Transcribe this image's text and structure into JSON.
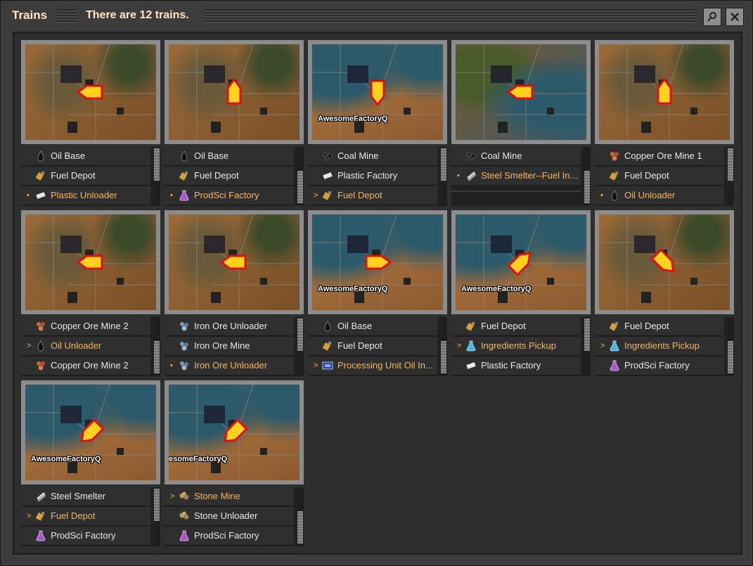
{
  "window": {
    "title": "Trains",
    "subtitle": "There are 12 trains.",
    "search_icon": "magnifier",
    "close_icon": "x"
  },
  "trains": [
    {
      "map": "dark-orange",
      "arrow": "left",
      "station_label": "",
      "stops": [
        {
          "label": "Oil Base",
          "icon": "oil-drop",
          "marker": "",
          "active": false
        },
        {
          "label": "Fuel Depot",
          "icon": "fuel",
          "marker": "",
          "active": false
        },
        {
          "label": "Plastic Unloader",
          "icon": "plastic",
          "marker": "•",
          "active": true
        }
      ]
    },
    {
      "map": "dark-orange",
      "arrow": "up",
      "station_label": "",
      "stops": [
        {
          "label": "Oil Base",
          "icon": "oil-drop",
          "marker": "",
          "active": false
        },
        {
          "label": "Fuel Depot",
          "icon": "fuel",
          "marker": "",
          "active": false
        },
        {
          "label": "ProdSci Factory",
          "icon": "purple-flask",
          "marker": "•",
          "active": true
        }
      ]
    },
    {
      "map": "blue-orange",
      "arrow": "down",
      "station_label": "AwesomeFactoryQ",
      "stops": [
        {
          "label": "Coal Mine",
          "icon": "coal",
          "marker": "",
          "active": false
        },
        {
          "label": "Plastic Factory",
          "icon": "plastic",
          "marker": "",
          "active": false
        },
        {
          "label": "Fuel Depot",
          "icon": "fuel",
          "marker": ">",
          "active": true
        }
      ]
    },
    {
      "map": "blue-green",
      "arrow": "left",
      "station_label": "",
      "stops": [
        {
          "label": "Coal Mine",
          "icon": "coal",
          "marker": "",
          "active": false
        },
        {
          "label": "Steel Smelter--Fuel In...",
          "icon": "steel",
          "marker": "•",
          "active": true
        }
      ]
    },
    {
      "map": "dark-orange",
      "arrow": "up",
      "station_label": "",
      "stops": [
        {
          "label": "Copper Ore Mine 1",
          "icon": "copper-ore",
          "marker": "",
          "active": false
        },
        {
          "label": "Fuel Depot",
          "icon": "fuel",
          "marker": "",
          "active": false
        },
        {
          "label": "Oil Unloader",
          "icon": "oil-drop",
          "marker": "•",
          "active": true
        }
      ]
    },
    {
      "map": "dark-orange",
      "arrow": "left",
      "station_label": "",
      "stops": [
        {
          "label": "Copper Ore Mine 2",
          "icon": "copper-ore",
          "marker": "",
          "active": false
        },
        {
          "label": "Oil Unloader",
          "icon": "oil-drop",
          "marker": ">",
          "active": true
        },
        {
          "label": "Copper Ore Mine 2",
          "icon": "copper-ore",
          "marker": "",
          "active": false
        }
      ]
    },
    {
      "map": "dark-orange",
      "arrow": "left",
      "station_label": "",
      "stops": [
        {
          "label": "Iron Ore Unloader",
          "icon": "iron-ore",
          "marker": "",
          "active": false
        },
        {
          "label": "Iron Ore Mine",
          "icon": "iron-ore",
          "marker": "",
          "active": false
        },
        {
          "label": "Iron Ore Unloader",
          "icon": "iron-ore",
          "marker": "•",
          "active": true
        }
      ]
    },
    {
      "map": "blue-orange",
      "arrow": "right",
      "station_label": "AwesomeFactoryQ",
      "stops": [
        {
          "label": "Oil Base",
          "icon": "oil-drop",
          "marker": "",
          "active": false
        },
        {
          "label": "Fuel Depot",
          "icon": "fuel",
          "marker": "",
          "active": false
        },
        {
          "label": "Processing Unit Oil In...",
          "icon": "processing-unit",
          "marker": ">",
          "active": true
        }
      ]
    },
    {
      "map": "blue-orange",
      "arrow": "up-right",
      "station_label": "AwesomeFactoryQ",
      "stops": [
        {
          "label": "Fuel Depot",
          "icon": "fuel",
          "marker": "",
          "active": false
        },
        {
          "label": "Ingredients Pickup",
          "icon": "blue-flask",
          "marker": ">",
          "active": true
        },
        {
          "label": "Plastic Factory",
          "icon": "plastic",
          "marker": "",
          "active": false
        }
      ]
    },
    {
      "map": "dark-orange",
      "arrow": "down-right",
      "station_label": "",
      "stops": [
        {
          "label": "Fuel Depot",
          "icon": "fuel",
          "marker": "",
          "active": false
        },
        {
          "label": "Ingredients Pickup",
          "icon": "blue-flask",
          "marker": ">",
          "active": true
        },
        {
          "label": "ProdSci Factory",
          "icon": "purple-flask",
          "marker": "",
          "active": false
        }
      ]
    },
    {
      "map": "blue-orange",
      "arrow": "down-left",
      "station_label": "AwesomeFactoryQ",
      "stops": [
        {
          "label": "Steel Smelter",
          "icon": "steel",
          "marker": "",
          "active": false
        },
        {
          "label": "Fuel Depot",
          "icon": "fuel",
          "marker": ">",
          "active": true
        },
        {
          "label": "ProdSci Factory",
          "icon": "purple-flask",
          "marker": "",
          "active": false
        }
      ]
    },
    {
      "map": "blue-orange",
      "arrow": "down-left",
      "station_label": "esomeFactoryQ",
      "stops": [
        {
          "label": "Stone Mine",
          "icon": "stone",
          "marker": ">",
          "active": true
        },
        {
          "label": "Stone Unloader",
          "icon": "stone",
          "marker": "",
          "active": false
        },
        {
          "label": "ProdSci Factory",
          "icon": "purple-flask",
          "marker": "",
          "active": false
        }
      ]
    }
  ]
}
